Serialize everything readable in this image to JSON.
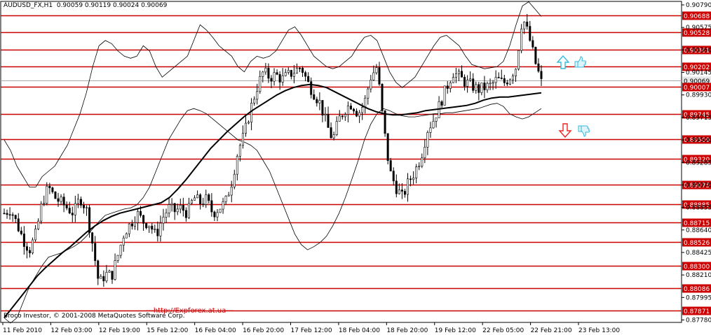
{
  "header": {
    "symbol": "AUDUSD_FX,H1",
    "ohlc": "0.90059 0.90119 0.90024 0.90069"
  },
  "footer": {
    "copyright": "Broco Investor, © 2001-2008 MetaQuotes Software Corp.",
    "link": "---http://Expforex.at.ua---"
  },
  "colors": {
    "background": "#ffffff",
    "grid_frame": "#000000",
    "level_line": "#cc0000",
    "candle": "#000000",
    "up_arrow": "#33bbdd",
    "down_arrow": "#ee2222",
    "thumb": "#33bbdd"
  },
  "signals": [
    {
      "type": "up-arrow",
      "icon": "up-arrow-icon"
    },
    {
      "type": "thumb-up",
      "icon": "thumb-up-icon"
    },
    {
      "type": "down-arrow",
      "icon": "down-arrow-icon"
    },
    {
      "type": "thumb-down",
      "icon": "thumb-down-icon"
    }
  ],
  "chart_data": {
    "type": "candlestick",
    "ylim": [
      0.8777,
      0.9079
    ],
    "y_ticks": [
      "0.90790",
      "0.90575",
      "0.90360",
      "0.90145",
      "0.89930",
      "0.89715",
      "0.89500",
      "0.89285",
      "0.89070",
      "0.88855",
      "0.88640",
      "0.88425",
      "0.88210",
      "0.87995",
      "0.87780"
    ],
    "x_ticks": [
      "11 Feb 2010",
      "12 Feb 03:00",
      "12 Feb 19:00",
      "15 Feb 12:00",
      "16 Feb 04:00",
      "16 Feb 20:00",
      "17 Feb 12:00",
      "18 Feb 04:00",
      "18 Feb 20:00",
      "19 Feb 12:00",
      "22 Feb 05:00",
      "22 Feb 21:00",
      "23 Feb 13:00"
    ],
    "levels": [
      "0.90688",
      "0.90528",
      "0.90361",
      "0.90202",
      "0.90069",
      "0.90007",
      "0.89745",
      "0.89509",
      "0.89320",
      "0.89075",
      "0.88885",
      "0.88715",
      "0.88526",
      "0.88300",
      "0.88086",
      "0.87871"
    ],
    "current_price": "0.90069",
    "close_path": [
      0.888,
      0.8884,
      0.887,
      0.8855,
      0.8845,
      0.886,
      0.889,
      0.8905,
      0.8895,
      0.889,
      0.8885,
      0.888,
      0.8895,
      0.8884,
      0.885,
      0.8812,
      0.8822,
      0.882,
      0.884,
      0.8862,
      0.887,
      0.888,
      0.8872,
      0.887,
      0.8858,
      0.8875,
      0.8885,
      0.8882,
      0.8885,
      0.888,
      0.8895,
      0.889,
      0.8893,
      0.888,
      0.8885,
      0.889,
      0.891,
      0.894,
      0.8955,
      0.898,
      0.9,
      0.9015,
      0.901,
      0.9012,
      0.9008,
      0.9012,
      0.9016,
      0.902,
      0.9005,
      0.8995,
      0.8985,
      0.8965,
      0.895,
      0.897,
      0.898,
      0.8985,
      0.8975,
      0.8985,
      0.901,
      0.902,
      0.8965,
      0.892,
      0.8905,
      0.8895,
      0.891,
      0.892,
      0.8935,
      0.896,
      0.897,
      0.8985,
      0.9,
      0.9015,
      0.901,
      0.9005,
      0.9002,
      0.8998,
      0.9,
      0.9002,
      0.9008,
      0.9004,
      0.901,
      0.902,
      0.9068,
      0.905,
      0.9025,
      0.9005
    ],
    "bollinger_upper": [
      0.895,
      0.894,
      0.8925,
      0.8915,
      0.8905,
      0.8905,
      0.8915,
      0.892,
      0.8925,
      0.8935,
      0.8945,
      0.896,
      0.8975,
      0.8995,
      0.902,
      0.904,
      0.9045,
      0.9042,
      0.9035,
      0.903,
      0.9028,
      0.903,
      0.904,
      0.9035,
      0.902,
      0.901,
      0.9015,
      0.902,
      0.9025,
      0.903,
      0.9045,
      0.906,
      0.9055,
      0.9048,
      0.904,
      0.9035,
      0.903,
      0.902,
      0.9015,
      0.9025,
      0.903,
      0.9028,
      0.903,
      0.9035,
      0.9045,
      0.9055,
      0.9058,
      0.905,
      0.904,
      0.903,
      0.9025,
      0.902,
      0.9018,
      0.902,
      0.9025,
      0.903,
      0.904,
      0.9048,
      0.905,
      0.9045,
      0.903,
      0.9015,
      0.9005,
      0.9,
      0.9005,
      0.901,
      0.902,
      0.903,
      0.904,
      0.9048,
      0.905,
      0.9045,
      0.904,
      0.903,
      0.9022,
      0.902,
      0.9018,
      0.9019,
      0.902,
      0.9025,
      0.904,
      0.906,
      0.9078,
      0.9082,
      0.9075,
      0.9068
    ],
    "bollinger_lower": [
      0.878,
      0.8775,
      0.878,
      0.8795,
      0.881,
      0.882,
      0.883,
      0.8838,
      0.884,
      0.8842,
      0.8845,
      0.8848,
      0.8852,
      0.8858,
      0.8865,
      0.8872,
      0.8878,
      0.888,
      0.8882,
      0.8884,
      0.8885,
      0.8888,
      0.8895,
      0.8905,
      0.892,
      0.8935,
      0.895,
      0.896,
      0.897,
      0.8978,
      0.898,
      0.8978,
      0.8975,
      0.897,
      0.8965,
      0.896,
      0.8955,
      0.895,
      0.8948,
      0.8945,
      0.894,
      0.893,
      0.892,
      0.8905,
      0.889,
      0.8875,
      0.886,
      0.885,
      0.8845,
      0.8848,
      0.8852,
      0.8858,
      0.8868,
      0.888,
      0.8895,
      0.8912,
      0.893,
      0.895,
      0.8965,
      0.8975,
      0.898,
      0.8978,
      0.8975,
      0.8973,
      0.8972,
      0.8972,
      0.8973,
      0.8974,
      0.8975,
      0.8975,
      0.8976,
      0.8976,
      0.8977,
      0.8978,
      0.8979,
      0.898,
      0.8982,
      0.8984,
      0.8985,
      0.8982,
      0.8975,
      0.8972,
      0.897,
      0.8972,
      0.8976,
      0.898
    ],
    "moving_average": [
      0.878,
      0.879,
      0.88,
      0.881,
      0.882,
      0.8828,
      0.8835,
      0.8842,
      0.8848,
      0.8855,
      0.8862,
      0.8868,
      0.8873,
      0.8877,
      0.888,
      0.8882,
      0.8884,
      0.8886,
      0.8888,
      0.889,
      0.8895,
      0.8903,
      0.8912,
      0.8922,
      0.8932,
      0.8942,
      0.895,
      0.8958,
      0.8965,
      0.8972,
      0.8978,
      0.8983,
      0.8988,
      0.8993,
      0.8997,
      0.9,
      0.9002,
      0.9003,
      0.9002,
      0.9,
      0.8996,
      0.8992,
      0.8988,
      0.8984,
      0.898,
      0.8977,
      0.8975,
      0.8974,
      0.8974,
      0.8975,
      0.8976,
      0.8978,
      0.8979,
      0.898,
      0.8981,
      0.8982,
      0.8983,
      0.8985,
      0.8988,
      0.899,
      0.8991,
      0.8991,
      0.8992,
      0.8993,
      0.8994,
      0.8995
    ]
  }
}
